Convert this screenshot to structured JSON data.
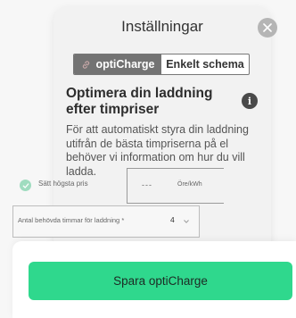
{
  "header": {
    "title": "Inställningar"
  },
  "segment": {
    "tabs": [
      {
        "label": "optiCharge",
        "active": true
      },
      {
        "label": "Enkelt schema",
        "active": false
      }
    ]
  },
  "main": {
    "heading": "Optimera din laddning efter timpriser",
    "description": "För att automatiskt styra din laddning utifrån de bästa timpriserna på el behöver vi information om hur du vill ladda."
  },
  "price": {
    "checkbox_label": "Sätt högsta pris",
    "value": "---",
    "unit": "Öre/kWh"
  },
  "hours": {
    "label": "Antal behövda timmar för laddning *",
    "value": "4"
  },
  "footer": {
    "save_label": "Spara optiCharge"
  },
  "colors": {
    "accent": "#2fd88d",
    "segment_active": "#737373",
    "check": "#9fdcbf"
  },
  "icons": {
    "close": "close-icon",
    "link": "link-icon",
    "info": "info-icon",
    "check": "check-icon",
    "chevron": "chevron-down-icon"
  }
}
